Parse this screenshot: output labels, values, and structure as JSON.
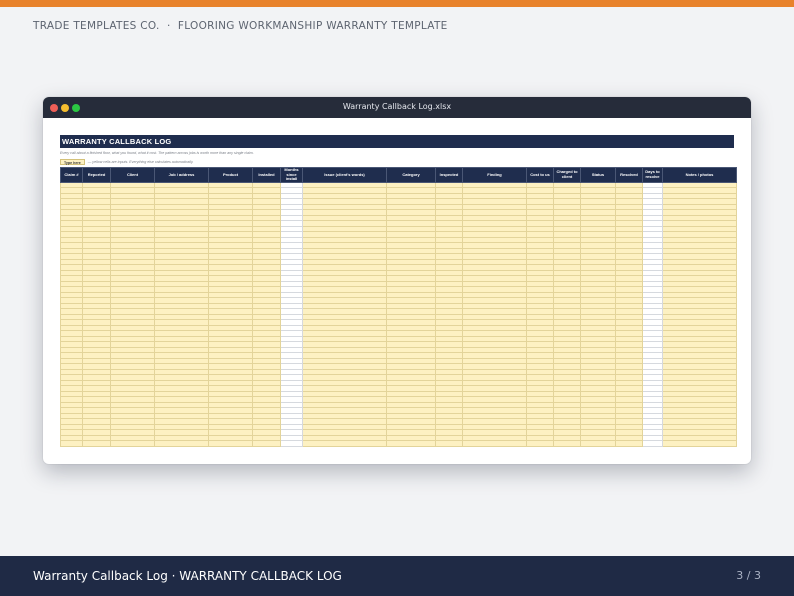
{
  "header": {
    "brand": "TRADE TEMPLATES CO.",
    "separator": "·",
    "doc_title": "FLOORING WORKMANSHIP WARRANTY TEMPLATE"
  },
  "window": {
    "title": "Warranty Callback Log.xlsx"
  },
  "sheet": {
    "title": "WARRANTY CALLBACK LOG",
    "subtitle": "Every call about a finished floor, what you found, what it cost. The pattern across jobs is worth more than any single claim.",
    "type_here_label": "Type here",
    "type_here_note": "— yellow cells are inputs. Everything else calculates automatically.",
    "columns": [
      {
        "label": "Claim #",
        "kind": "input"
      },
      {
        "label": "Reported",
        "kind": "input"
      },
      {
        "label": "Client",
        "kind": "input"
      },
      {
        "label": "Job / address",
        "kind": "input"
      },
      {
        "label": "Product",
        "kind": "input"
      },
      {
        "label": "Installed",
        "kind": "input"
      },
      {
        "label": "Months since install",
        "kind": "calc"
      },
      {
        "label": "Issue (client's words)",
        "kind": "input"
      },
      {
        "label": "Category",
        "kind": "input"
      },
      {
        "label": "Inspected",
        "kind": "input"
      },
      {
        "label": "Finding",
        "kind": "input"
      },
      {
        "label": "Cost to us",
        "kind": "input"
      },
      {
        "label": "Charged to client",
        "kind": "input"
      },
      {
        "label": "Status",
        "kind": "input"
      },
      {
        "label": "Resolved",
        "kind": "input"
      },
      {
        "label": "Days to resolve",
        "kind": "calc"
      },
      {
        "label": "Notes / photos",
        "kind": "input"
      }
    ]
  },
  "footer": {
    "left": "Warranty Callback Log · WARRANTY CALLBACK LOG",
    "page": "3 / 3"
  },
  "colors": {
    "accent_stripe": "#e8822b",
    "navy": "#1f2d4e",
    "input_cell": "#fdf1c2",
    "footer_bg": "#1f2a45"
  }
}
